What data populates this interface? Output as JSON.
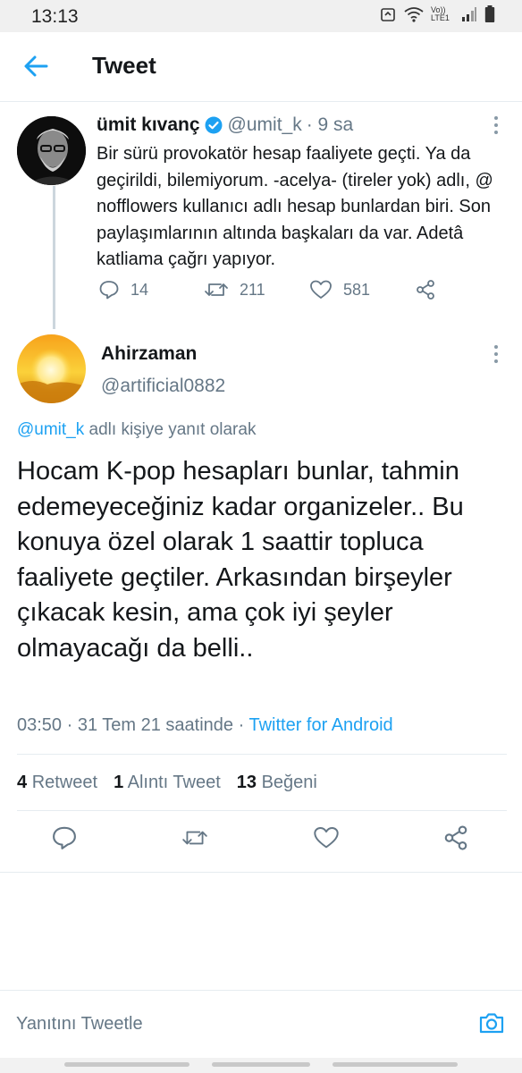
{
  "status_bar": {
    "time": "13:13",
    "network_label": "Vo)) LTE1"
  },
  "app_bar": {
    "title": "Tweet",
    "back_icon": "arrow-left-icon"
  },
  "parent_tweet": {
    "name": "ümit kıvanç",
    "handle": "@umit_k",
    "time": "· 9 sa",
    "text": "Bir sürü provokatör hesap faaliyete geçti. Ya da geçirildi, bilemiyorum. -acelya- (tireler yok) adlı, @ nofflowers kullanıcı adlı hesap bunlardan biri. Son paylaşımlarının altında başkaları da var. Adetâ katliama çağrı yapıyor.",
    "replies": "14",
    "retweets": "211",
    "likes": "581"
  },
  "main_tweet": {
    "name": "Ahirzaman",
    "handle": "@artificial0882",
    "reply_to_link": "@umit_k",
    "reply_to_suffix": "adlı kişiye yanıt olarak",
    "text": "Hocam K-pop hesapları bunlar, tahmin edemeyeceğiniz kadar organizeler.. Bu konuya özel olarak 1  saattir topluca faaliyete geçtiler. Arkasından birşeyler çıkacak kesin, ama çok iyi şeyler olmayacağı da belli..",
    "timestamp": "03:50 · 31 Tem 21 saatinde ·",
    "source": "Twitter for Android"
  },
  "stats": {
    "retweets_count": "4",
    "retweets_label": "Retweet",
    "quotes_count": "1",
    "quotes_label": "Alıntı Tweet",
    "likes_count": "13",
    "likes_label": "Beğeni"
  },
  "compose": {
    "placeholder": "Yanıtını Tweetle"
  },
  "colors": {
    "accent": "#1da1f2",
    "muted": "#657786",
    "text": "#14171a",
    "divider": "#e6ecf0"
  }
}
